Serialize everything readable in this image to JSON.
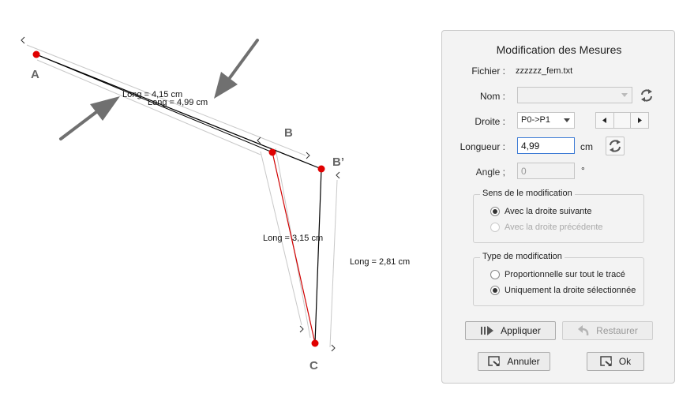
{
  "canvas": {
    "points": {
      "a": "A",
      "b": "B",
      "b_prime": "B’",
      "c": "C"
    },
    "measures": {
      "ab_original": "Long = 4,15 cm",
      "ab_modified": "Long = 4,99 cm",
      "bc_original": "Long = 3,15 cm",
      "bc_modified": "Long = 2,81 cm"
    },
    "colors": {
      "point": "#e00000",
      "selected_segment": "#d00000",
      "segment": "#000000",
      "arrow": "#707070"
    }
  },
  "dialog": {
    "title": "Modification des Mesures",
    "file_label": "Fichier :",
    "file_value": "zzzzzz_fem.txt",
    "name_label": "Nom :",
    "name_value": "",
    "line_label": "Droite :",
    "line_value": "P0->P1",
    "length_label": "Longueur :",
    "length_value": "4,99",
    "length_unit": "cm",
    "angle_label": "Angle ;",
    "angle_value": "0",
    "angle_unit": "°",
    "direction_group": {
      "title": "Sens de le modification",
      "options": [
        {
          "label": "Avec la droite suivante",
          "selected": true,
          "enabled": true
        },
        {
          "label": "Avec la droite précédente",
          "selected": false,
          "enabled": false
        }
      ]
    },
    "type_group": {
      "title": "Type de modification",
      "options": [
        {
          "label": "Proportionnelle sur tout le tracé",
          "selected": false,
          "enabled": true
        },
        {
          "label": "Uniquement la droite sélectionnée",
          "selected": true,
          "enabled": true
        }
      ]
    },
    "apply_label": "Appliquer",
    "restore_label": "Restaurer",
    "cancel_label": "Annuler",
    "ok_label": "Ok"
  }
}
